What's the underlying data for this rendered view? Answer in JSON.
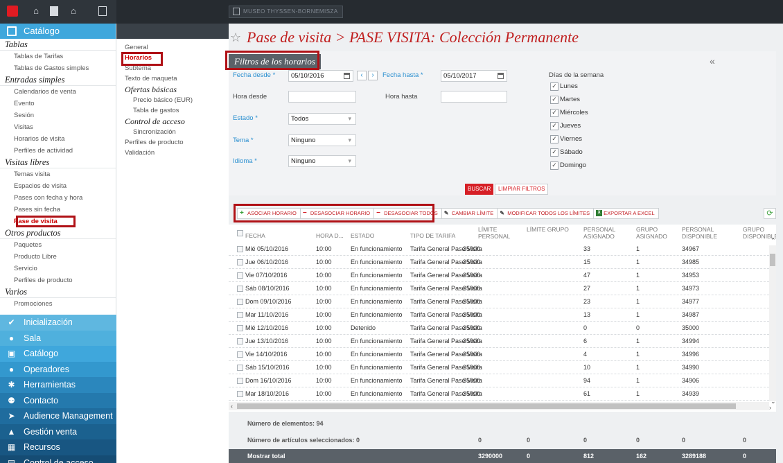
{
  "topbar": {
    "icons": [
      "stop-icon",
      "building-icon",
      "document-icon",
      "home-icon",
      "calculator-icon"
    ],
    "crumb": "MUSEO THYSSEN-BORNEMISZA"
  },
  "leftnav": {
    "header": "Catálogo",
    "sections": [
      {
        "title": "Tablas",
        "items": [
          "Tablas de Tarifas",
          "Tablas de Gastos simples"
        ]
      },
      {
        "title": "Entradas simples",
        "items": [
          "Calendarios de venta",
          "Evento",
          "Sesión",
          "Visitas",
          "Horarios de visita",
          "Perfiles de actividad"
        ]
      },
      {
        "title": "Visitas libres",
        "items": [
          "Temas visita",
          "Espacios de visita",
          "Pases con fecha y hora",
          "Pases sin fecha",
          "Pase de visita"
        ]
      },
      {
        "title": "Otros productos",
        "items": [
          "Paquetes",
          "Producto Libre",
          "Servicio",
          "Perfiles de producto"
        ]
      },
      {
        "title": "Varios",
        "items": [
          "Promociones"
        ]
      }
    ],
    "menu": [
      {
        "label": "Inicialización",
        "icon": "check-circle-icon",
        "color": "#5fb7e0"
      },
      {
        "label": "Sala",
        "icon": "map-pin-icon",
        "color": "#4fb0dd"
      },
      {
        "label": "Catálogo",
        "icon": "catalog-icon",
        "color": "#3fa7dc"
      },
      {
        "label": "Operadores",
        "icon": "user-icon",
        "color": "#3398ce"
      },
      {
        "label": "Herramientas",
        "icon": "gear-icon",
        "color": "#2b87bd"
      },
      {
        "label": "Contacto",
        "icon": "contacts-icon",
        "color": "#2479ad"
      },
      {
        "label": "Audience Management",
        "icon": "send-icon",
        "color": "#1f6c9e"
      },
      {
        "label": "Gestión venta",
        "icon": "chart-icon",
        "color": "#1b618f"
      },
      {
        "label": "Recursos",
        "icon": "calendar-icon",
        "color": "#185682"
      },
      {
        "label": "Control de acceso",
        "icon": "access-icon",
        "color": "#154c74"
      }
    ]
  },
  "subnav": {
    "general": "General",
    "horarios": "Horarios",
    "subtema": "Subtema",
    "texto": "Texto de maqueta",
    "ofertas": "Ofertas básicas",
    "precio": "Precio básico (EUR)",
    "tabla_gastos": "Tabla de gastos",
    "control": "Control de acceso",
    "sincronizacion": "Sincronización",
    "perfiles": "Perfiles de producto",
    "validacion": "Validación"
  },
  "main": {
    "title": "Pase de visita > PASE VISITA: Colección Permanente",
    "filter_title": "Filtros de los horarios",
    "collapse": "«",
    "filters": {
      "fecha_desde_label": "Fecha desde *",
      "fecha_desde": "05/10/2016",
      "fecha_hasta_label": "Fecha hasta *",
      "fecha_hasta": "05/10/2017",
      "hora_desde_label": "Hora desde",
      "hora_hasta_label": "Hora hasta",
      "estado_label": "Estado *",
      "estado": "Todos",
      "tema_label": "Tema *",
      "tema": "Ninguno",
      "idioma_label": "Idioma *",
      "idioma": "Ninguno",
      "dias_label": "Días de la semana",
      "dias": [
        "Lunes",
        "Martes",
        "Miércoles",
        "Jueves",
        "Viernes",
        "Sábado",
        "Domingo"
      ]
    },
    "buscar": "BUSCAR",
    "limpiar": "LIMPIAR FILTROS",
    "toolbar": {
      "asociar": "ASOCIAR HORARIO",
      "desasociar": "DESASOCIAR HORARIO",
      "desasociar_todos": "DESASOCIAR TODOS",
      "cambiar": "CAMBIAR LÍMITE",
      "modificar": "MODIFICAR TODOS LOS LÍMITES",
      "exportar": "EXPORTAR A EXCEL"
    },
    "columns": [
      "FECHA",
      "HORA D...",
      "ESTADO",
      "TIPO DE TARIFA",
      "LÍMITE PERSONAL",
      "LÍMITE GRUPO",
      "PERSONAL ASIGNADO",
      "GRUPO ASIGNADO",
      "PERSONAL DISPONIBLE",
      "GRUPO DISPONIBLE"
    ],
    "rows": [
      {
        "fecha": "Mié 05/10/2016",
        "hora": "10:00",
        "estado": "En funcionamiento",
        "tarifa": "Tarifa General Pase Visita",
        "limite": "35000",
        "pasig": "33",
        "gasig": "1",
        "pdisp": "34967"
      },
      {
        "fecha": "Jue 06/10/2016",
        "hora": "10:00",
        "estado": "En funcionamiento",
        "tarifa": "Tarifa General Pase Visita",
        "limite": "35000",
        "pasig": "15",
        "gasig": "1",
        "pdisp": "34985"
      },
      {
        "fecha": "Vie 07/10/2016",
        "hora": "10:00",
        "estado": "En funcionamiento",
        "tarifa": "Tarifa General Pase Visita",
        "limite": "35000",
        "pasig": "47",
        "gasig": "1",
        "pdisp": "34953"
      },
      {
        "fecha": "Sáb 08/10/2016",
        "hora": "10:00",
        "estado": "En funcionamiento",
        "tarifa": "Tarifa General Pase Visita",
        "limite": "35000",
        "pasig": "27",
        "gasig": "1",
        "pdisp": "34973"
      },
      {
        "fecha": "Dom 09/10/2016",
        "hora": "10:00",
        "estado": "En funcionamiento",
        "tarifa": "Tarifa General Pase Visita",
        "limite": "35000",
        "pasig": "23",
        "gasig": "1",
        "pdisp": "34977"
      },
      {
        "fecha": "Mar 11/10/2016",
        "hora": "10:00",
        "estado": "En funcionamiento",
        "tarifa": "Tarifa General Pase Visita",
        "limite": "35000",
        "pasig": "13",
        "gasig": "1",
        "pdisp": "34987"
      },
      {
        "fecha": "Mié 12/10/2016",
        "hora": "10:00",
        "estado": "Detenido",
        "tarifa": "Tarifa General Pase Visita",
        "limite": "35000",
        "pasig": "0",
        "gasig": "0",
        "pdisp": "35000"
      },
      {
        "fecha": "Jue 13/10/2016",
        "hora": "10:00",
        "estado": "En funcionamiento",
        "tarifa": "Tarifa General Pase Visita",
        "limite": "35000",
        "pasig": "6",
        "gasig": "1",
        "pdisp": "34994"
      },
      {
        "fecha": "Vie 14/10/2016",
        "hora": "10:00",
        "estado": "En funcionamiento",
        "tarifa": "Tarifa General Pase Visita",
        "limite": "35000",
        "pasig": "4",
        "gasig": "1",
        "pdisp": "34996"
      },
      {
        "fecha": "Sáb 15/10/2016",
        "hora": "10:00",
        "estado": "En funcionamiento",
        "tarifa": "Tarifa General Pase Visita",
        "limite": "35000",
        "pasig": "10",
        "gasig": "1",
        "pdisp": "34990"
      },
      {
        "fecha": "Dom 16/10/2016",
        "hora": "10:00",
        "estado": "En funcionamiento",
        "tarifa": "Tarifa General Pase Visita",
        "limite": "35000",
        "pasig": "94",
        "gasig": "1",
        "pdisp": "34906"
      },
      {
        "fecha": "Mar 18/10/2016",
        "hora": "10:00",
        "estado": "En funcionamiento",
        "tarifa": "Tarifa General Pase Visita",
        "limite": "35000",
        "pasig": "61",
        "gasig": "1",
        "pdisp": "34939"
      }
    ],
    "footer": {
      "num_elementos": "Número de elementos: 94",
      "seleccionados": "Número de artículos seleccionados: 0",
      "sel_values": [
        "0",
        "0",
        "0",
        "0",
        "0",
        "0"
      ],
      "mostrar_total": "Mostrar total",
      "total_values": [
        "3290000",
        "0",
        "812",
        "162",
        "3289188",
        "0"
      ]
    }
  }
}
